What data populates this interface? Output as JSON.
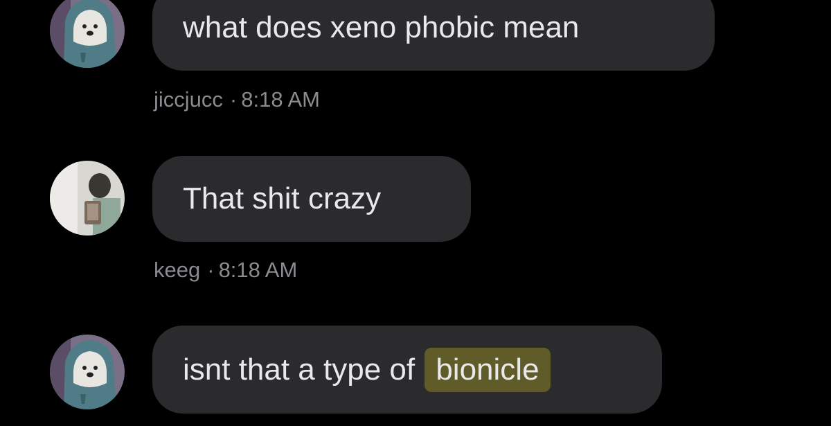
{
  "messages": [
    {
      "text": "what does xeno phobic mean",
      "username": "jiccjucc",
      "separator": "·",
      "time": "8:18 AM",
      "avatar": "hooded-bear-avatar"
    },
    {
      "text": "That shit crazy",
      "username": "keeg",
      "separator": "·",
      "time": "8:18 AM",
      "avatar": "person-photo-avatar"
    },
    {
      "text": "isnt that a type of",
      "highlighted_text": "bionicle",
      "avatar": "hooded-bear-avatar"
    }
  ],
  "colors": {
    "background": "#000000",
    "bubble": "#2b2b2e",
    "message_text": "#e9e9ec",
    "meta_text": "#8b8b90",
    "highlight": "#5f5c2a"
  }
}
